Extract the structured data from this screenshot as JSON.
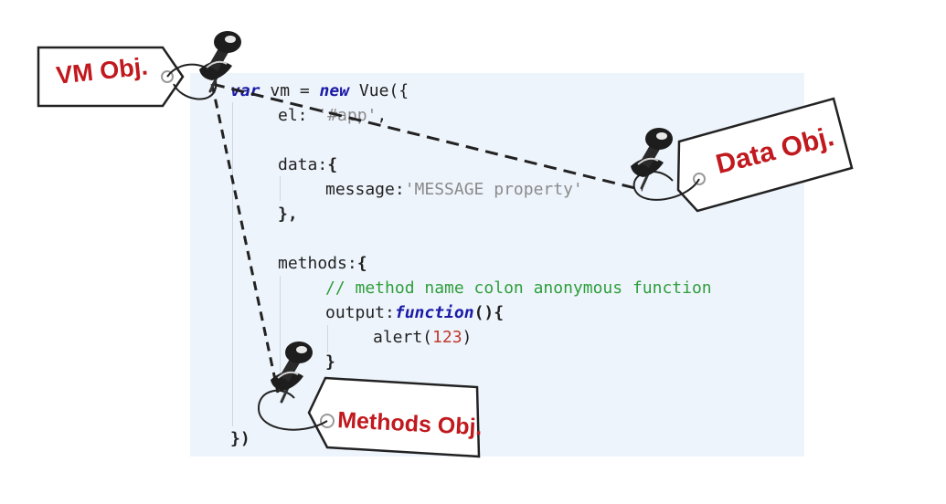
{
  "code": {
    "line1": {
      "kw_var": "var",
      "mid": " vm = ",
      "kw_new": "new",
      "end": " Vue({"
    },
    "line2": {
      "key": "el:",
      "value": "'#app'",
      "end": ","
    },
    "line3": {
      "key": "data:",
      "end": "{"
    },
    "line4": {
      "key": "message:",
      "value": "'MESSAGE property'"
    },
    "line5": {
      "text": "},"
    },
    "line6": {
      "key": "methods:",
      "end": "{"
    },
    "line7": {
      "comment": "// method name colon anonymous function"
    },
    "line8": {
      "key": "output:",
      "kw_function": "function",
      "end": "(){"
    },
    "line9": {
      "call": "alert(",
      "num": "123",
      "end": ")"
    },
    "line10": {
      "text": "}"
    },
    "line11": {
      "text": "})"
    }
  },
  "tags": {
    "vm": "VM Obj.",
    "data": "Data Obj.",
    "methods": "Methods Obj."
  },
  "colors": {
    "code_background": "#eef4fc",
    "keyword": "#1a1aa6",
    "string": "#8a8a8a",
    "number": "#c0392b",
    "comment": "#2e9e3a",
    "tag_text": "#c0191e",
    "pin": "#222222"
  }
}
